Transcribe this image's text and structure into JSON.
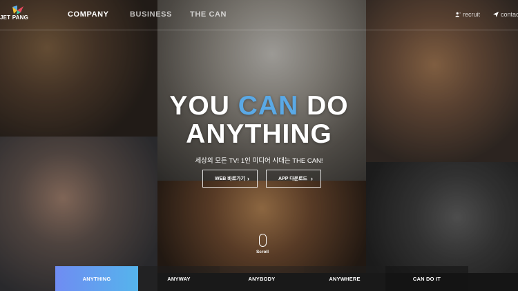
{
  "header": {
    "logo_text": "JET PANG",
    "nav": [
      "COMPANY",
      "BUSINESS",
      "THE CAN"
    ],
    "utility": [
      {
        "label": "recruit",
        "icon": "person-add-icon"
      },
      {
        "label": "contact",
        "icon": "paper-plane-icon"
      }
    ]
  },
  "hero": {
    "title_part1": "YOU ",
    "title_accent": "CAN",
    "title_part2": " DO",
    "title_line2": "ANYTHING",
    "subtitle": "세상의 모든 TV! 1인 미디어 시대는 THE CAN!",
    "buttons": [
      {
        "label": "WEB 바로가기"
      },
      {
        "label": "APP 다운로드"
      }
    ],
    "scroll_label": "Scroll"
  },
  "tabs": [
    "ANYTHING",
    "ANYWAY",
    "ANYBODY",
    "ANYWHERE",
    "CAN DO IT"
  ],
  "colors": {
    "accent": "#5aa9e6",
    "active_tab_start": "#6f8cf2",
    "active_tab_end": "#55b4ec"
  }
}
